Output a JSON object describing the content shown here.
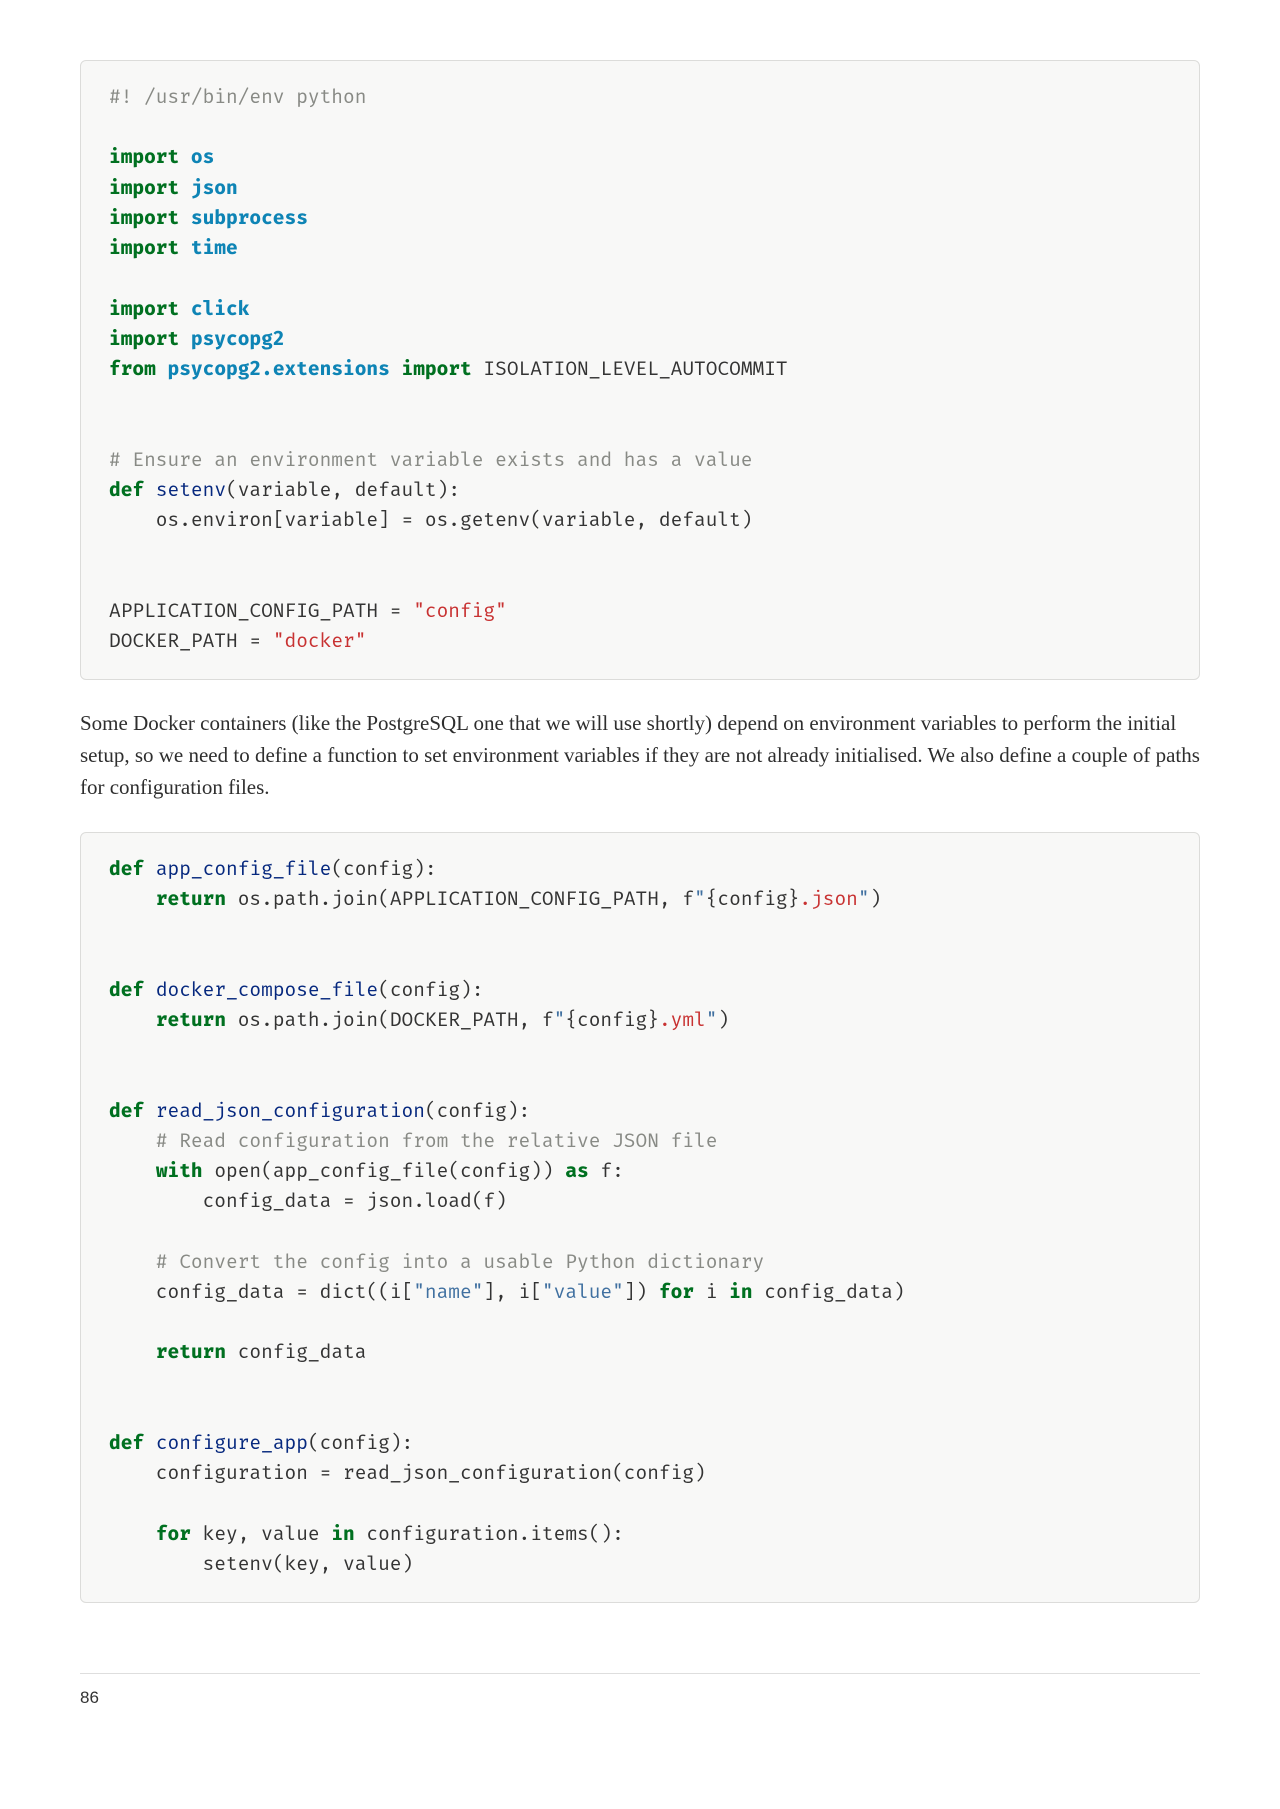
{
  "page_number": "86",
  "paragraph": "Some Docker containers (like the PostgreSQL one that we will use shortly) depend on environment variables to perform the initial setup, so we need to define a function to set environment variables if they are not already initialised. We also define a couple of paths for configuration files.",
  "code1": {
    "l01": "#! /usr/bin/env python",
    "kw_import": "import",
    "kw_from": "from",
    "kw_def": "def",
    "mod_os": "os",
    "mod_json": "json",
    "mod_subprocess": "subprocess",
    "mod_time": "time",
    "mod_click": "click",
    "mod_psycopg2": "psycopg2",
    "mod_psycopg2_ext": "psycopg2.extensions",
    "sym_isolation": " ISOLATION_LEVEL_AUTOCOMMIT",
    "cm_ensure": "# Ensure an environment variable exists and has a value",
    "fn_setenv": "setenv",
    "setenv_params": "(variable, default):",
    "setenv_body": "    os.environ[variable] = os.getenv(variable, default)",
    "app_cfg_lhs": "APPLICATION_CONFIG_PATH = ",
    "app_cfg_str": "\"config\"",
    "docker_lhs": "DOCKER_PATH = ",
    "docker_str": "\"docker\""
  },
  "code2": {
    "kw_def": "def",
    "kw_return": "return",
    "kw_with": "with",
    "kw_as": "as",
    "kw_for": "for",
    "kw_in": "in",
    "fn_app_config_file": "app_config_file",
    "acf_params": "(config):",
    "acf_ret_pre": " os.path.join(APPLICATION_CONFIG_PATH, f",
    "acf_ret_q1": "\"",
    "acf_ret_interp": "{config}",
    "acf_ret_suffix": ".json",
    "acf_ret_q2": "\"",
    "acf_ret_close": ")",
    "fn_docker_compose_file": "docker_compose_file",
    "dcf_params": "(config):",
    "dcf_ret_pre": " os.path.join(DOCKER_PATH, f",
    "dcf_ret_q1": "\"",
    "dcf_ret_interp": "{config}",
    "dcf_ret_suffix": ".yml",
    "dcf_ret_q2": "\"",
    "dcf_ret_close": ")",
    "fn_read_json": "read_json_configuration",
    "rjc_params": "(config):",
    "rjc_cm1": "    # Read configuration from the relative JSON file",
    "rjc_open_pre": " open(app_config_file(config)) ",
    "rjc_open_post": " f:",
    "rjc_body1": "        config_data = json.load(f)",
    "rjc_cm2": "    # Convert the config into a usable Python dictionary",
    "rjc_dict_pre": "    config_data = dict((i[",
    "rjc_str_name": "\"name\"",
    "rjc_mid1": "], i[",
    "rjc_str_value": "\"value\"",
    "rjc_mid2": "]) ",
    "rjc_post_for": " i ",
    "rjc_post_in": " config_data)",
    "rjc_ret": " config_data",
    "fn_configure_app": "configure_app",
    "ca_params": "(config):",
    "ca_line1": "    configuration = read_json_configuration(config)",
    "ca_for_pre": " key, value ",
    "ca_for_post": " configuration.items():",
    "ca_body": "        setenv(key, value)"
  }
}
